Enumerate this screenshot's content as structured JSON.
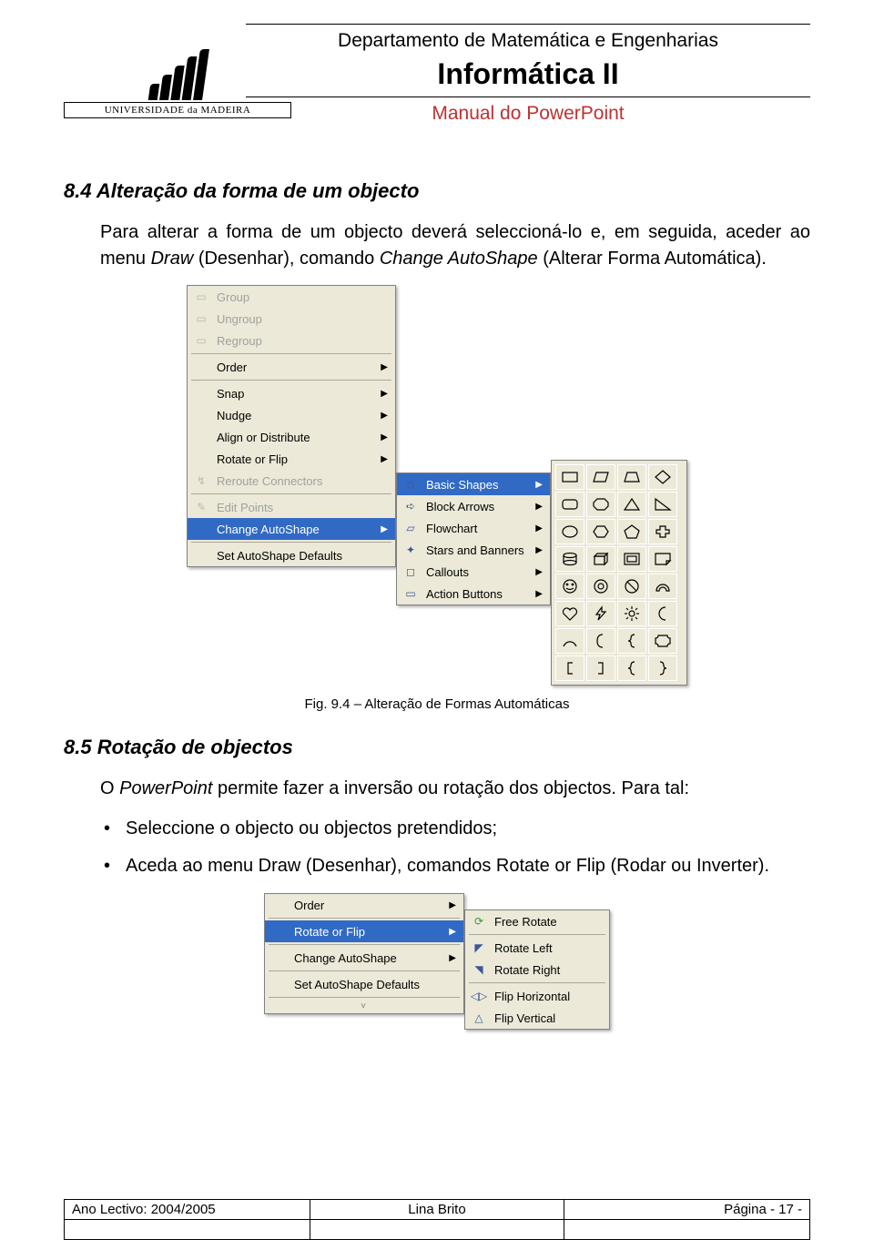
{
  "header": {
    "dept": "Departamento de Matemática e Engenharias",
    "course": "Informática II",
    "manual": "Manual do PowerPoint",
    "university": "UNIVERSIDADE da MADEIRA"
  },
  "section1": {
    "heading": "8.4  Alteração da forma de um objecto",
    "para_pre": "Para alterar a forma de um objecto deverá seleccioná-lo e, em seguida, aceder ao menu ",
    "para_i1": "Draw",
    "para_mid1": " (Desenhar), comando ",
    "para_i2": "Change AutoShape",
    "para_mid2": " (Alterar Forma Automática).",
    "caption": "Fig. 9.4 – Alteração de Formas Automáticas"
  },
  "menu1": {
    "group": "Group",
    "ungroup": "Ungroup",
    "regroup": "Regroup",
    "order": "Order",
    "snap": "Snap",
    "nudge": "Nudge",
    "align": "Align or Distribute",
    "rotate": "Rotate or Flip",
    "reroute": "Reroute Connectors",
    "edit": "Edit Points",
    "change": "Change AutoShape",
    "defaults": "Set AutoShape Defaults",
    "sub": {
      "basic": "Basic Shapes",
      "block": "Block Arrows",
      "flow": "Flowchart",
      "stars": "Stars and Banners",
      "callouts": "Callouts",
      "action": "Action Buttons"
    }
  },
  "section2": {
    "heading": "8.5  Rotação de objectos",
    "para_pre": "O ",
    "para_i1": "PowerPoint",
    "para_post": " permite fazer a inversão ou rotação dos objectos. Para tal:",
    "bullets": [
      {
        "text": "Seleccione o objecto ou objectos pretendidos;"
      },
      {
        "pre": "Aceda ao menu ",
        "i1": "Draw",
        "mid1": " (Desenhar), comandos ",
        "i2": "Rotate or Flip",
        "post": " (Rodar ou Inverter)."
      }
    ]
  },
  "menu2": {
    "order": "Order",
    "rotate": "Rotate or Flip",
    "change": "Change AutoShape",
    "defaults": "Set AutoShape Defaults",
    "sub": {
      "free": "Free Rotate",
      "left": "Rotate Left",
      "right": "Rotate Right",
      "fh": "Flip Horizontal",
      "fv": "Flip Vertical"
    }
  },
  "footer": {
    "year": "Ano Lectivo: 2004/2005",
    "author": "Lina Brito",
    "page": "Página  - 17 -"
  }
}
